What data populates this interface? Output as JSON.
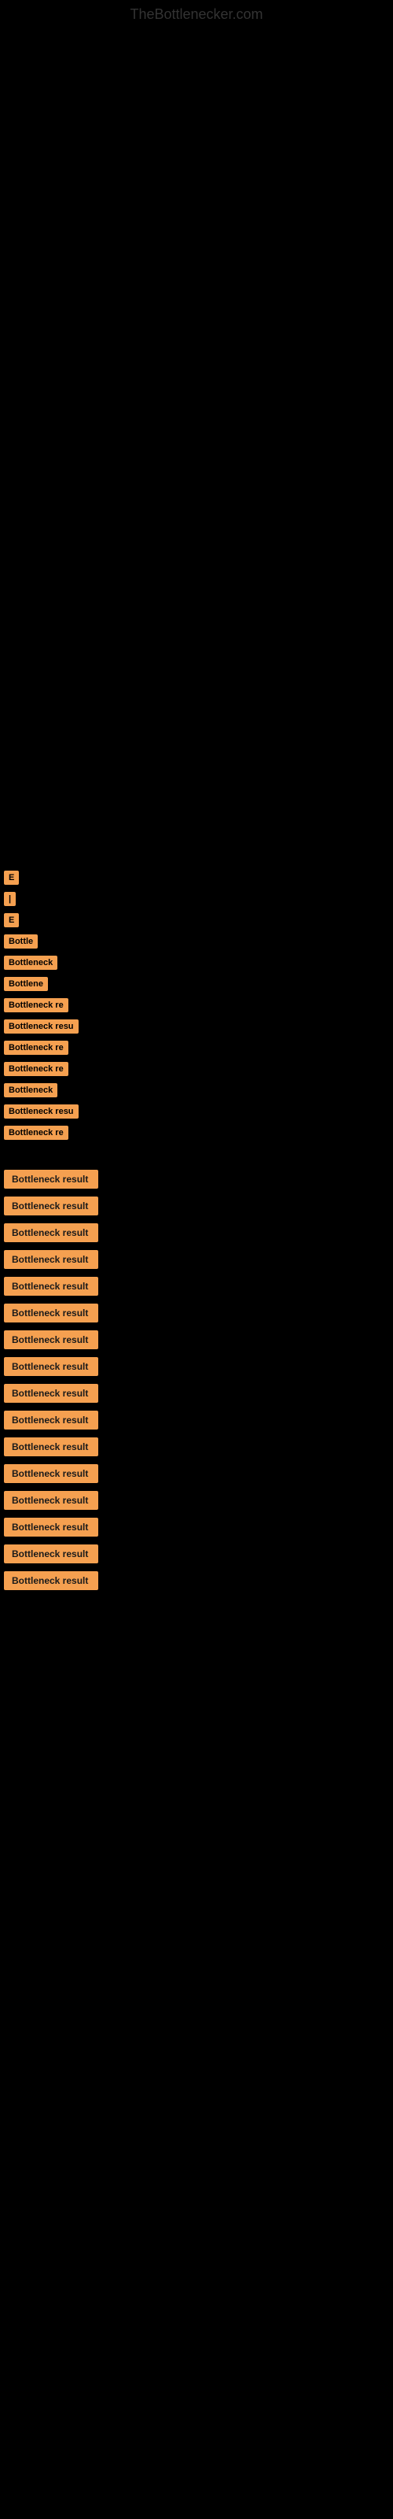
{
  "site": {
    "title": "TheBottlenecker.com"
  },
  "labels": {
    "label1": "E",
    "label2": "|",
    "label3": "E",
    "label4": "Bottle",
    "label5": "Bottleneck",
    "label6": "Bottlene",
    "label7": "Bottleneck re",
    "label8": "Bottleneck resu",
    "label9": "Bottleneck re",
    "label10": "Bottleneck re",
    "label11": "Bottleneck",
    "label12": "Bottleneck resu",
    "label13": "Bottleneck re"
  },
  "results": [
    {
      "text": "Bottleneck result",
      "width": "120"
    },
    {
      "text": "Bottleneck result",
      "width": "120"
    },
    {
      "text": "Bottleneck result",
      "width": "120"
    },
    {
      "text": "Bottleneck result",
      "width": "120"
    },
    {
      "text": "Bottleneck result",
      "width": "120"
    },
    {
      "text": "Bottleneck result",
      "width": "120"
    },
    {
      "text": "Bottleneck result",
      "width": "120"
    },
    {
      "text": "Bottleneck result",
      "width": "120"
    },
    {
      "text": "Bottleneck result",
      "width": "120"
    },
    {
      "text": "Bottleneck result",
      "width": "120"
    },
    {
      "text": "Bottleneck result",
      "width": "120"
    },
    {
      "text": "Bottleneck result",
      "width": "120"
    },
    {
      "text": "Bottleneck result",
      "width": "120"
    },
    {
      "text": "Bottleneck result",
      "width": "120"
    },
    {
      "text": "Bottleneck result",
      "width": "120"
    },
    {
      "text": "Bottleneck result",
      "width": "120"
    }
  ]
}
